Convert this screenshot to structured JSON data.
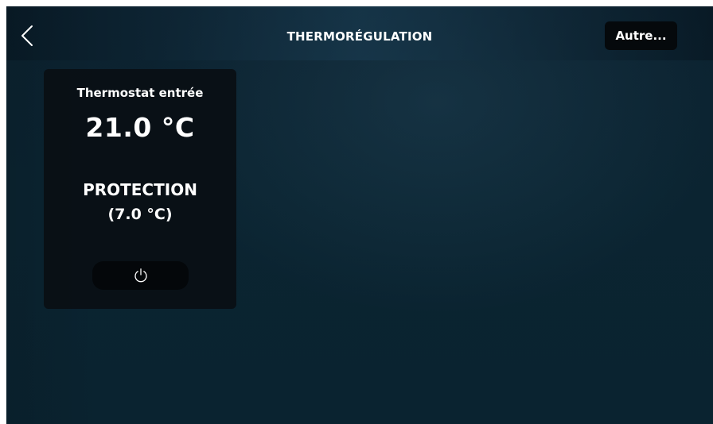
{
  "header": {
    "title": "THERMORÉGULATION",
    "back_icon": "chevron-left-icon",
    "more_label": "Autre..."
  },
  "thermostat_card": {
    "name": "Thermostat entrée",
    "current_temperature": "21.0 °C",
    "mode": "PROTECTION",
    "setpoint": "(7.0 °C)",
    "power_icon": "power-icon"
  },
  "colors": {
    "background": "#0b2431",
    "header_band": "#193c52",
    "card": "#090e12",
    "button": "#05090c",
    "text": "#ffffff"
  }
}
